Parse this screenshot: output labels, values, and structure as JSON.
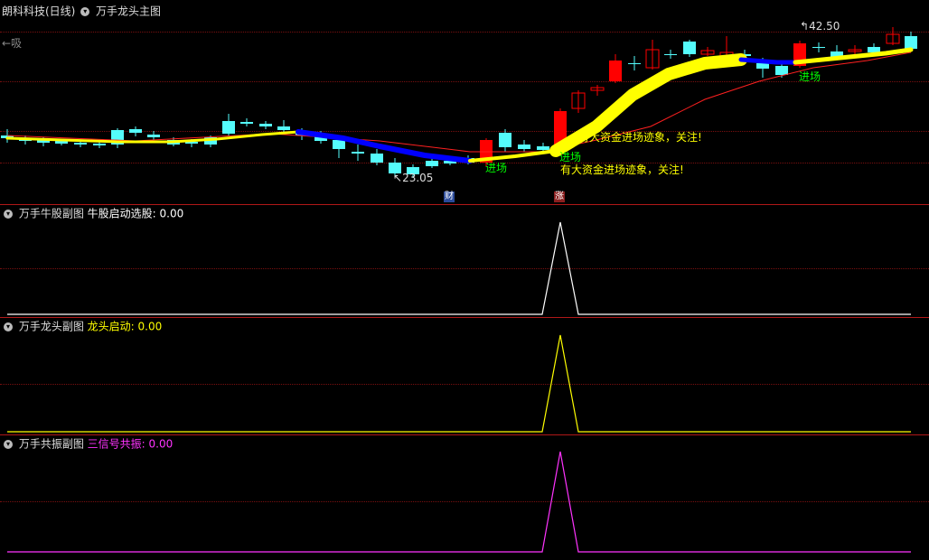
{
  "main": {
    "stock_name": "朗科科技(日线)",
    "indicator": "万手龙头主图",
    "left_marker": "←吸",
    "high_label": "42.50",
    "low_label": "23.05",
    "signals": [
      "进场",
      "进场",
      "进场"
    ],
    "messages": [
      "有大资金进场迹象，关注!",
      "有大资金进场迹象，关注!"
    ],
    "badge_cai": "财",
    "badge_zhang": "涨"
  },
  "sub1": {
    "title": "万手牛股副图",
    "label": "牛股启动选股:",
    "value": "0.00",
    "color": "#ffffff"
  },
  "sub2": {
    "title": "万手龙头副图",
    "label": "龙头启动:",
    "value": "0.00",
    "color": "#ffff00"
  },
  "sub3": {
    "title": "万手共振副图",
    "label": "三信号共振:",
    "value": "0.00",
    "color": "#ff33ff"
  },
  "colors": {
    "up": "#ff0000",
    "down": "#54fcfc",
    "ma_rising": "#ffff00",
    "ma_falling": "#0000ff",
    "ma_thin": "#ff2020",
    "signal_text": "#00ff00",
    "message_text": "#ffff00"
  }
}
